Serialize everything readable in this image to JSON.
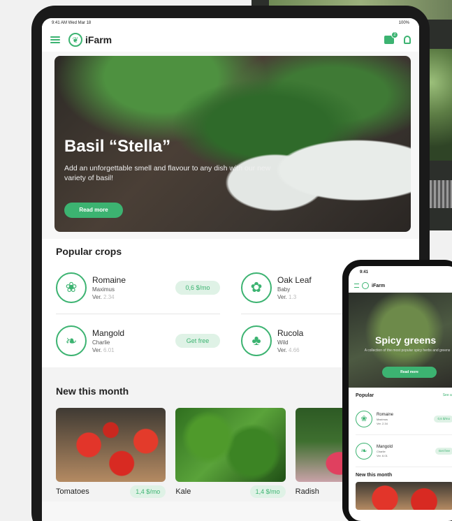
{
  "tablet": {
    "status": {
      "time": "9:41 AM  Wed Mar 18",
      "battery": "100%"
    },
    "app_bar": {
      "logo_text": "iFarm",
      "cart_count": "2"
    },
    "hero": {
      "title": "Basil “Stella”",
      "subtitle": "Add an unforgettable smell and flavour to any dish with our new variety of basil!",
      "button": "Read more"
    },
    "popular": {
      "title": "Popular crops",
      "items": [
        {
          "name": "Romaine",
          "variety": "Maximus",
          "ver_label": "Ver.",
          "ver": "2.34",
          "action": "0,6 $/mo"
        },
        {
          "name": "Oak Leaf",
          "variety": "Baby",
          "ver_label": "Ver.",
          "ver": "1.3",
          "action": ""
        },
        {
          "name": "Mangold",
          "variety": "Charlie",
          "ver_label": "Ver.",
          "ver": "6.01",
          "action": "Get free"
        },
        {
          "name": "Rucola",
          "variety": "Wild",
          "ver_label": "Ver.",
          "ver": "4.66",
          "action": ""
        }
      ]
    },
    "new_month": {
      "title": "New this month",
      "cards": [
        {
          "name": "Tomatoes",
          "price": "1,4 $/mo"
        },
        {
          "name": "Kale",
          "price": "1,4 $/mo"
        },
        {
          "name": "Radish",
          "price": ""
        }
      ]
    }
  },
  "phone": {
    "status": {
      "time": "9:41"
    },
    "app_bar": {
      "logo_text": "iFarm"
    },
    "hero": {
      "title": "Spicy greens",
      "subtitle": "A collection of the most popular spicy herbs and greens",
      "button": "Read more"
    },
    "popular": {
      "title": "Popular",
      "see_all": "See all",
      "items": [
        {
          "name": "Romaine",
          "variety": "Maximus",
          "ver": "Ver. 2.34",
          "action": "0,6 $/mo"
        },
        {
          "name": "Mangold",
          "variety": "Charlie",
          "ver": "Ver. 6.01",
          "action": "Get free"
        }
      ]
    },
    "new_month": {
      "title": "New this month"
    }
  },
  "colors": {
    "accent": "#3cb371",
    "accent_light": "#dff2e6"
  }
}
